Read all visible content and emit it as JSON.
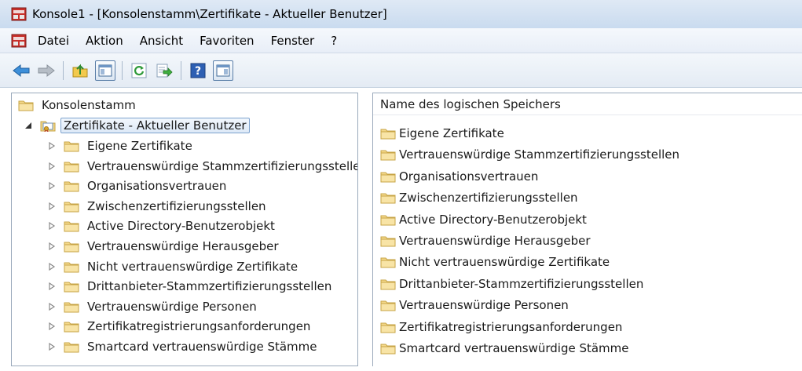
{
  "window": {
    "title": "Konsole1 - [Konsolenstamm\\Zertifikate - Aktueller Benutzer]"
  },
  "menubar": {
    "items": [
      "Datei",
      "Aktion",
      "Ansicht",
      "Favoriten",
      "Fenster",
      "?"
    ]
  },
  "toolbar": {
    "buttons": [
      "back-icon",
      "forward-icon",
      "up-folder-icon",
      "show-hide-tree-icon",
      "refresh-icon",
      "export-list-icon",
      "help-icon",
      "show-hide-action-pane-icon"
    ]
  },
  "tree": {
    "root_label": "Konsolenstamm",
    "snapin_label": "Zertifikate - Aktueller Benutzer",
    "children": [
      "Eigene Zertifikate",
      "Vertrauenswürdige Stammzertifizierungsstellen",
      "Organisationsvertrauen",
      "Zwischenzertifizierungsstellen",
      "Active Directory-Benutzerobjekt",
      "Vertrauenswürdige Herausgeber",
      "Nicht vertrauenswürdige Zertifikate",
      "Drittanbieter-Stammzertifizierungsstellen",
      "Vertrauenswürdige Personen",
      "Zertifikatregistrierungsanforderungen",
      "Smartcard vertrauenswürdige Stämme"
    ]
  },
  "list": {
    "column_header": "Name des logischen Speichers",
    "items": [
      "Eigene Zertifikate",
      "Vertrauenswürdige Stammzertifizierungsstellen",
      "Organisationsvertrauen",
      "Zwischenzertifizierungsstellen",
      "Active Directory-Benutzerobjekt",
      "Vertrauenswürdige Herausgeber",
      "Nicht vertrauenswürdige Zertifikate",
      "Drittanbieter-Stammzertifizierungsstellen",
      "Vertrauenswürdige Personen",
      "Zertifikatregistrierungsanforderungen",
      "Smartcard vertrauenswürdige Stämme"
    ]
  },
  "colors": {
    "folder": "#f2d27a",
    "selection_border": "#7da2ce",
    "titlebar": "#c9dbef"
  }
}
